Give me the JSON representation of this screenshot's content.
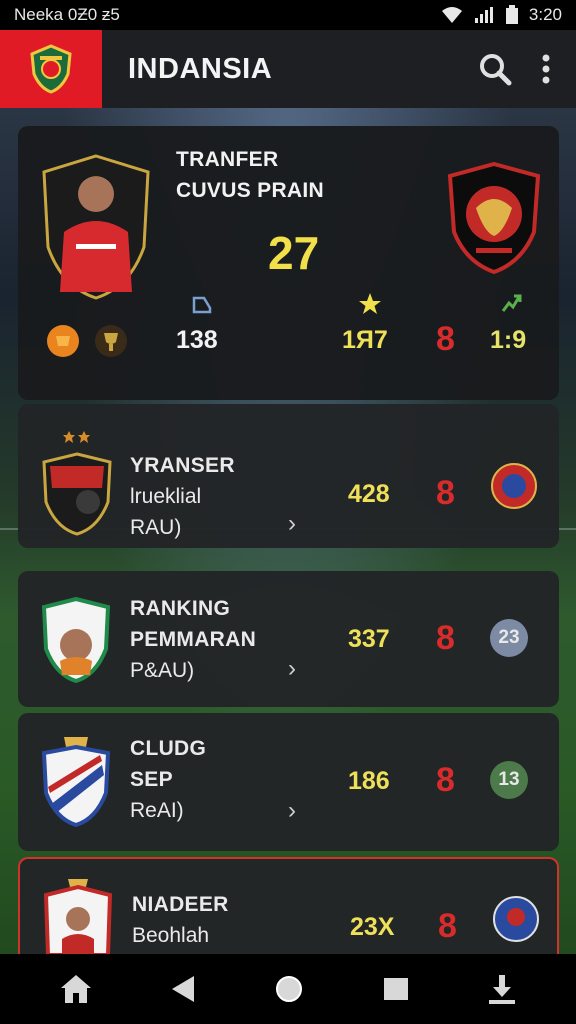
{
  "status_bar": {
    "left": "Neeka 0Ƶ0 ƶ5",
    "time": "3:20"
  },
  "app_bar": {
    "title": "INDANSIA",
    "search_icon": "search-icon",
    "menu_icon": "more-vert-icon"
  },
  "hero": {
    "title_line1": "TRANFER",
    "title_line2": "CUVUS PRAIN",
    "score": "27",
    "stats": [
      {
        "value": "138",
        "icon": "boot-icon"
      },
      {
        "value": "1Я7",
        "icon": "star-icon"
      },
      {
        "value": "8",
        "icon": ""
      },
      {
        "value": "1:9",
        "icon": "chart-icon"
      }
    ]
  },
  "rows": [
    {
      "line1": "YRANSER",
      "line2": "lrueklial",
      "line3": "RAU)",
      "value": "428",
      "eight": "8",
      "badge_text": ""
    },
    {
      "line1": "RANKING",
      "line2": "PEMMARAN",
      "line3": "P&AU)",
      "value": "337",
      "eight": "8",
      "badge_text": "23"
    },
    {
      "line1": "CLUDG",
      "line2": "SEP",
      "line3": "ReAI)",
      "value": "186",
      "eight": "8",
      "badge_text": "13"
    },
    {
      "line1": "NIADEER",
      "line2": "Beohlah",
      "line3": "",
      "value": "23X",
      "eight": "8",
      "badge_text": ""
    }
  ],
  "colors": {
    "accent_red": "#e11b25",
    "score_yellow": "#f1e04a",
    "stat_red": "#d82c2c"
  },
  "nav": [
    "home-icon",
    "back-icon",
    "circle-home-icon",
    "recents-icon",
    "download-icon"
  ]
}
